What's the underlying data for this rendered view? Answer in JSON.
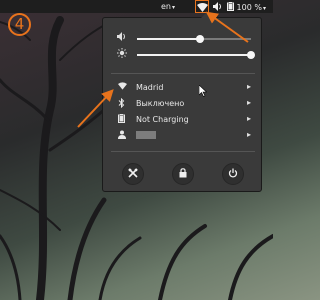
{
  "topbar": {
    "keyboard_layout": "en",
    "caret": "▾",
    "battery_percent": "100 %"
  },
  "badge": {
    "step": "4"
  },
  "menu": {
    "volume": {
      "level": 0.55,
      "icon": "speaker-icon"
    },
    "brightness": {
      "level": 1.0,
      "icon": "sun-icon"
    },
    "items": [
      {
        "icon": "wifi-icon",
        "label": "Madrid"
      },
      {
        "icon": "bluetooth-icon",
        "label": "Выключено"
      },
      {
        "icon": "battery-icon",
        "label": "Not Charging"
      },
      {
        "icon": "user-icon",
        "label": ""
      }
    ],
    "actions": [
      {
        "icon": "settings-icon"
      },
      {
        "icon": "lock-icon"
      },
      {
        "icon": "power-icon"
      }
    ]
  },
  "colors": {
    "annotation": "#e8731c",
    "topbar_bg": "#1e1e1e",
    "menu_bg": "#3a3a3a"
  }
}
